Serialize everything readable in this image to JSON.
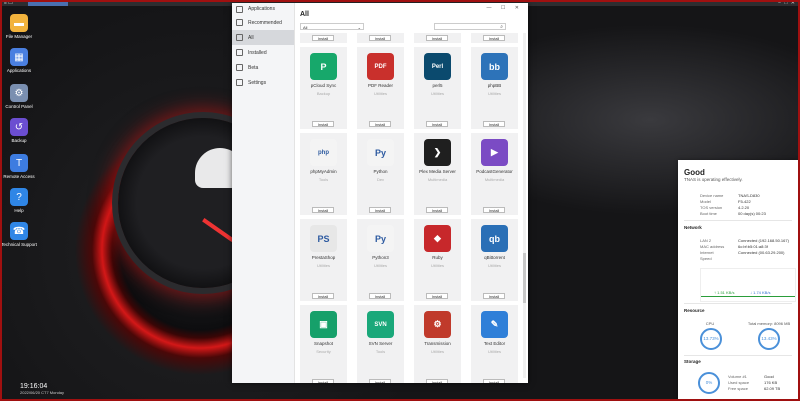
{
  "topbar": {
    "left": "≡ ☐",
    "tab": "",
    "right": "− □ ✕"
  },
  "desktop": [
    {
      "label": "File Manager",
      "icon": "folder-icon",
      "color": "#f2b33d",
      "glyph": "▬"
    },
    {
      "label": "Applications",
      "icon": "applications-icon",
      "color": "#4a7fe0",
      "glyph": "▦"
    },
    {
      "label": "Control Panel",
      "icon": "control-panel-icon",
      "color": "#7a8fb0",
      "glyph": "⚙"
    },
    {
      "label": "Backup",
      "icon": "backup-icon",
      "color": "#6b4ed1",
      "glyph": "↺"
    },
    {
      "label": "Remote Access",
      "icon": "remote-access-icon",
      "color": "#3d7ce0",
      "glyph": "T"
    },
    {
      "label": "Help",
      "icon": "help-icon",
      "color": "#2f86e6",
      "glyph": "?"
    },
    {
      "label": "Technical Support",
      "icon": "support-icon",
      "color": "#2f86e6",
      "glyph": "☎"
    }
  ],
  "clock": {
    "time": "19:16:04",
    "date": "2022/06/20 CT7 Monday"
  },
  "app_center": {
    "sidebar": [
      {
        "label": "Applications",
        "icon": "applications-icon"
      },
      {
        "label": "Recommended",
        "icon": "star-icon"
      },
      {
        "label": "All",
        "icon": "grid-icon"
      },
      {
        "label": "Installed",
        "icon": "installed-icon"
      },
      {
        "label": "Beta",
        "icon": "beta-icon"
      },
      {
        "label": "Settings",
        "icon": "gear-icon"
      }
    ],
    "title": "All",
    "filter": "All",
    "search_placeholder": "",
    "install_label": "Install",
    "rows": [
      [
        {
          "name": "pCloud Sync",
          "category": "Backup",
          "color": "#17a86b",
          "glyph": "P"
        },
        {
          "name": "PDF Reader",
          "category": "Utilities",
          "color": "#c9302c",
          "glyph": "PDF"
        },
        {
          "name": "perl5",
          "category": "Utilities",
          "color": "#0b4a6e",
          "glyph": "Perl"
        },
        {
          "name": "phpBB",
          "category": "Utilities",
          "color": "#2d73b9",
          "glyph": "bb"
        }
      ],
      [
        {
          "name": "phpMyAdmin",
          "category": "Tools",
          "color": "#f4f4f4",
          "glyph": "php",
          "dark": true
        },
        {
          "name": "Python",
          "category": "Dev",
          "color": "#f4f4f4",
          "glyph": "Py",
          "dark": true
        },
        {
          "name": "Plex Media Server",
          "category": "Multimedia",
          "color": "#1f1f1f",
          "glyph": "❯"
        },
        {
          "name": "PodcastGenerator",
          "category": "Multimedia",
          "color": "#7b4bc4",
          "glyph": "▶"
        }
      ],
      [
        {
          "name": "PrestaShop",
          "category": "Utilities",
          "color": "#e7e7e7",
          "glyph": "PS",
          "dark": true
        },
        {
          "name": "Python3",
          "category": "Utilities",
          "color": "#f4f4f4",
          "glyph": "Py",
          "dark": true
        },
        {
          "name": "Ruby",
          "category": "Utilities",
          "color": "#c7282b",
          "glyph": "◆"
        },
        {
          "name": "qBittorrent",
          "category": "Utilities",
          "color": "#2a6fb6",
          "glyph": "qb"
        }
      ],
      [
        {
          "name": "Snapshot",
          "category": "Security",
          "color": "#16a06a",
          "glyph": "▣"
        },
        {
          "name": "SVN Server",
          "category": "Tools",
          "color": "#1aa87a",
          "glyph": "SVN"
        },
        {
          "name": "Transmission",
          "category": "Utilities",
          "color": "#c03a2b",
          "glyph": "⚙"
        },
        {
          "name": "Text Editor",
          "category": "Utilities",
          "color": "#2f7fd8",
          "glyph": "✎"
        }
      ]
    ]
  },
  "status": {
    "headline": "Good",
    "sub": "TNAS is operating effectively.",
    "device": [
      {
        "k": "Device name",
        "v": "TNAS-D830"
      },
      {
        "k": "Model",
        "v": "F5-422"
      },
      {
        "k": "TOS version",
        "v": "4.2.20"
      },
      {
        "k": "Boot time",
        "v": "00 day(s) 00:23"
      }
    ],
    "network_title": "Network",
    "network": [
      {
        "k": "LAN 2",
        "v": "Connected (192.168.50.167)"
      },
      {
        "k": "MAC address",
        "v": "6c:bf:b5:01:a8:3f"
      },
      {
        "k": "Internet",
        "v": "Connected (00.63.29.200)"
      },
      {
        "k": "Speed",
        "v": ""
      }
    ],
    "speed_up": "↑ 1.51 KB/s",
    "speed_down": "↓ 1.74 KB/s",
    "resource_title": "Resource",
    "cpu_label": "CPU",
    "cpu_value": "13.73%",
    "mem_label": "Total memory: 8096 MB",
    "mem_value": "13.43%",
    "storage_title": "Storage",
    "storage_value": "0%",
    "volume": [
      {
        "k": "Volume #1",
        "v": "Good"
      },
      {
        "k": "Used space",
        "v": "176 KB"
      },
      {
        "k": "Free space",
        "v": "62.09 TB"
      }
    ]
  }
}
